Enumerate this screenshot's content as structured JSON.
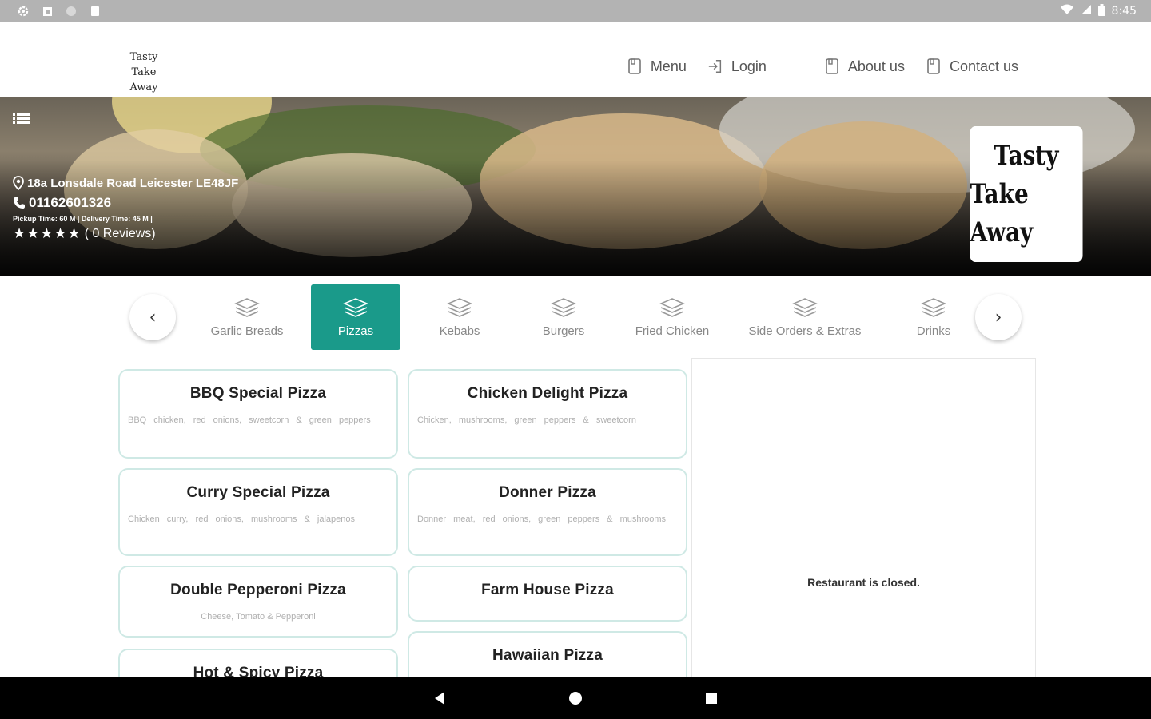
{
  "status_bar": {
    "time": "8:45",
    "icons": [
      "settings-icon",
      "calendar-icon",
      "circle-icon",
      "clipboard-icon",
      "wifi-icon",
      "signal-icon",
      "battery-icon"
    ]
  },
  "header": {
    "logo_line1": "Tasty",
    "logo_line2": "Take Away",
    "nav": [
      {
        "label": "Menu",
        "icon": "document-icon"
      },
      {
        "label": "Login",
        "icon": "login-icon"
      },
      {
        "label": "About us",
        "icon": "document-icon"
      },
      {
        "label": "Contact us",
        "icon": "document-icon"
      }
    ]
  },
  "hero": {
    "address": "18a Lonsdale Road Leicester LE48JF",
    "phone": "01162601326",
    "times": "Pickup Time: 60 M | Delivery Time: 45 M |",
    "stars": "★★★★★",
    "reviews": "( 0 Reviews)",
    "logo_line1": "Tasty",
    "logo_line2": "Take Away"
  },
  "categories": [
    {
      "label": "Garlic Breads",
      "active": false
    },
    {
      "label": "Pizzas",
      "active": true
    },
    {
      "label": "Kebabs",
      "active": false
    },
    {
      "label": "Burgers",
      "active": false
    },
    {
      "label": "Fried Chicken",
      "active": false
    },
    {
      "label": "Side Orders & Extras",
      "active": false
    },
    {
      "label": "Drinks",
      "active": false
    }
  ],
  "arrows": {
    "left": "‹",
    "right": "›"
  },
  "menu_items": [
    {
      "title": "BBQ Special Pizza",
      "desc": "BBQ chicken, red onions, sweetcorn & green peppers"
    },
    {
      "title": "Chicken Delight Pizza",
      "desc": "Chicken, mushrooms, green peppers & sweetcorn"
    },
    {
      "title": "Curry Special Pizza",
      "desc": "Chicken curry, red onions, mushrooms & jalapenos"
    },
    {
      "title": "Donner Pizza",
      "desc": "Donner meat, red onions, green peppers & mushrooms"
    },
    {
      "title": "Double Pepperoni Pizza",
      "desc": "Cheese, Tomato & Pepperoni"
    },
    {
      "title": "Farm House Pizza",
      "desc": ""
    },
    {
      "title": "Hot & Spicy Pizza",
      "desc": ""
    },
    {
      "title": "Hawaiian Pizza",
      "desc": ""
    }
  ],
  "cart": {
    "closed_message": "Restaurant is closed."
  },
  "colors": {
    "accent": "#1a9a8a",
    "card_border": "#cfe9e5",
    "status_bar": "#b3b3b3"
  }
}
